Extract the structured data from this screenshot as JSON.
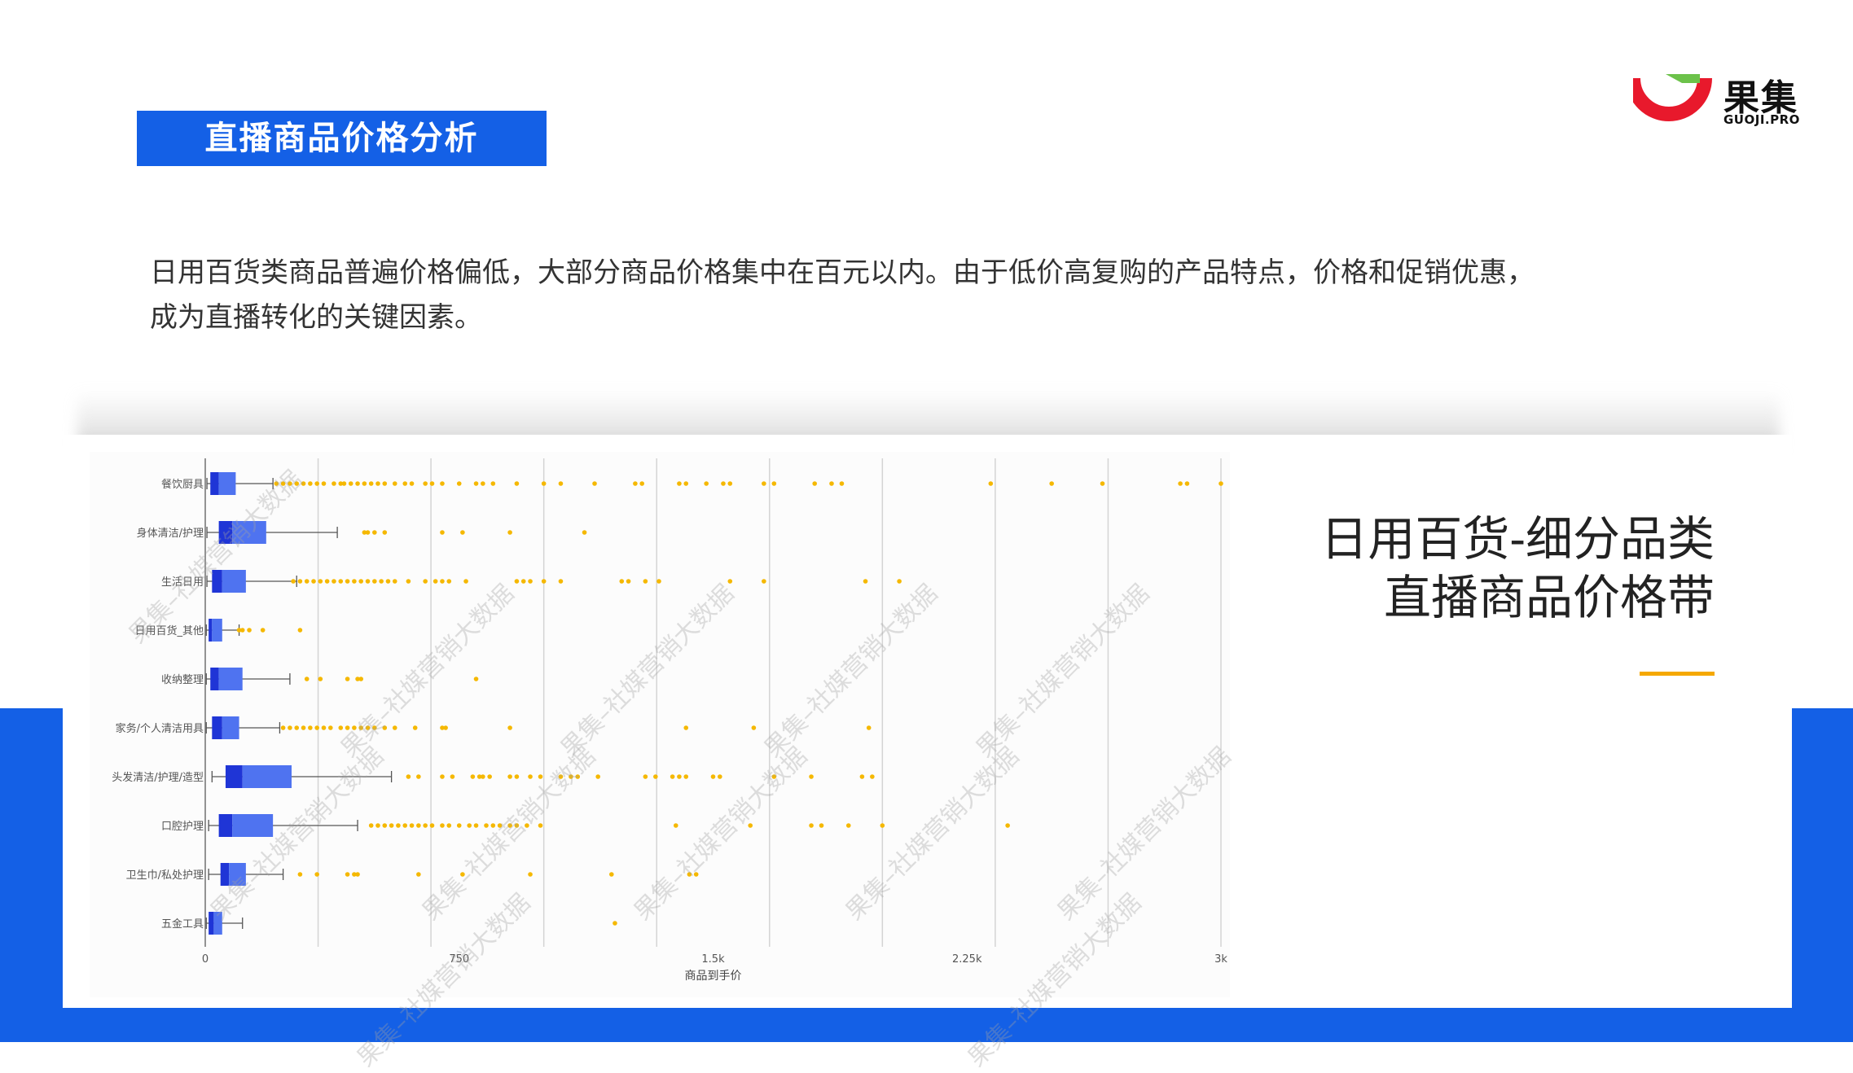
{
  "header": {
    "section_title": "直播商品价格分析",
    "logo_text": "果集",
    "logo_sub": "GUOJI.PRO"
  },
  "intro": {
    "line1": "日用百货类商品普遍价格偏低，大部分商品价格集中在百元以内。由于低价高复购的产品特点，价格和促销优惠，",
    "line2": "成为直播转化的关键因素。"
  },
  "side_title": {
    "line1": "日用百货-细分品类",
    "line2": "直播商品价格带"
  },
  "watermark": "果集–社媒营销大数据",
  "colors": {
    "brand_blue": "#1460e6",
    "box_dark": "#1f35d6",
    "box_light": "#4f73f0",
    "outlier": "#f5b800",
    "accent": "#f5a800",
    "logo_red": "#e8192c",
    "logo_green": "#6cc24a"
  },
  "chart_data": {
    "type": "box",
    "orientation": "horizontal",
    "xlabel": "商品到手价",
    "xlim": [
      0,
      3000
    ],
    "xticks": [
      0,
      750,
      1500,
      2250,
      3000
    ],
    "xtick_labels": [
      "0",
      "750",
      "1.5k",
      "2.25k",
      "3k"
    ],
    "grid": true,
    "categories": [
      "餐饮厨具",
      "身体清洁/护理",
      "生活日用",
      "日用百货_其他",
      "收纳整理",
      "家务/个人清洁用具",
      "头发清洁/护理/造型",
      "口腔护理",
      "卫生巾/私处护理",
      "五金工具"
    ],
    "boxes": [
      {
        "min": 5,
        "q1": 15,
        "median": 40,
        "q3": 90,
        "max": 200
      },
      {
        "min": 5,
        "q1": 40,
        "median": 80,
        "q3": 180,
        "max": 390
      },
      {
        "min": 5,
        "q1": 20,
        "median": 50,
        "q3": 120,
        "max": 270
      },
      {
        "min": 3,
        "q1": 10,
        "median": 20,
        "q3": 50,
        "max": 100
      },
      {
        "min": 3,
        "q1": 15,
        "median": 40,
        "q3": 110,
        "max": 250
      },
      {
        "min": 3,
        "q1": 20,
        "median": 50,
        "q3": 100,
        "max": 220
      },
      {
        "min": 20,
        "q1": 60,
        "median": 110,
        "q3": 255,
        "max": 550
      },
      {
        "min": 10,
        "q1": 40,
        "median": 80,
        "q3": 200,
        "max": 450
      },
      {
        "min": 10,
        "q1": 45,
        "median": 70,
        "q3": 120,
        "max": 230
      },
      {
        "min": 3,
        "q1": 10,
        "median": 25,
        "q3": 50,
        "max": 110
      }
    ],
    "outliers": [
      [
        210,
        230,
        250,
        270,
        290,
        310,
        330,
        350,
        380,
        400,
        410,
        430,
        450,
        470,
        490,
        510,
        530,
        560,
        590,
        610,
        650,
        670,
        700,
        750,
        800,
        820,
        850,
        920,
        1000,
        1050,
        1150,
        1270,
        1290,
        1400,
        1420,
        1480,
        1530,
        1550,
        1650,
        1680,
        1800,
        1850,
        1880,
        2320,
        2500,
        2650,
        2880,
        2900,
        3000
      ],
      [
        470,
        480,
        500,
        530,
        700,
        760,
        900,
        1120
      ],
      [
        260,
        280,
        300,
        320,
        340,
        360,
        380,
        400,
        420,
        440,
        460,
        480,
        500,
        520,
        540,
        560,
        600,
        650,
        680,
        700,
        720,
        770,
        920,
        940,
        960,
        1000,
        1050,
        1230,
        1250,
        1300,
        1340,
        1550,
        1650,
        1950,
        2050
      ],
      [
        100,
        110,
        130,
        170,
        280
      ],
      [
        300,
        340,
        420,
        450,
        460,
        800
      ],
      [
        230,
        250,
        270,
        290,
        310,
        330,
        350,
        370,
        400,
        420,
        440,
        460,
        480,
        500,
        530,
        560,
        620,
        700,
        710,
        900,
        1420,
        1620,
        1960
      ],
      [
        600,
        630,
        700,
        730,
        790,
        810,
        820,
        840,
        900,
        920,
        960,
        990,
        1050,
        1080,
        1100,
        1160,
        1300,
        1330,
        1380,
        1400,
        1420,
        1500,
        1520,
        1680,
        1790,
        1940,
        1970
      ],
      [
        490,
        510,
        530,
        550,
        570,
        590,
        610,
        630,
        650,
        670,
        700,
        720,
        750,
        780,
        800,
        830,
        850,
        870,
        900,
        920,
        950,
        990,
        1390,
        1610,
        1790,
        1820,
        1900,
        2000,
        2370
      ],
      [
        280,
        330,
        420,
        440,
        450,
        630,
        760,
        960,
        1200,
        1430,
        1450
      ],
      [
        1210
      ]
    ]
  }
}
